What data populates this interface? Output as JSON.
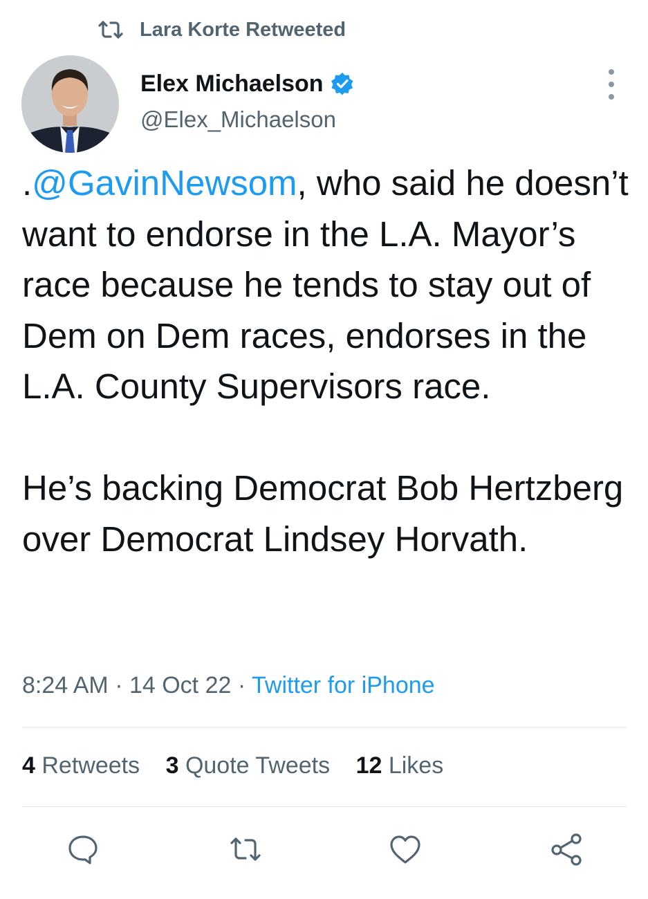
{
  "retweet_context": {
    "label": "Lara Korte Retweeted",
    "icon": "retweet-icon"
  },
  "author": {
    "name": "Elex Michaelson",
    "handle": "@Elex_Michaelson",
    "verified": true,
    "verified_icon": "verified-badge-icon"
  },
  "tweet": {
    "text_prefix": ".",
    "mention": "@GavinNewsom",
    "paragraph1_rest": ", who said he doesn’t want to endorse in the L.A. Mayor’s race because he tends to stay out of Dem on Dem races, endorses in the L.A. County Supervisors race.",
    "paragraph2": "He’s backing Democrat Bob Hertzberg over Democrat Lindsey Horvath."
  },
  "meta": {
    "time": "8:24 AM",
    "sep1": " · ",
    "date": "14 Oct 22",
    "sep2": " · ",
    "source": "Twitter for iPhone"
  },
  "stats": {
    "retweets_count": "4",
    "retweets_label": "Retweets",
    "quotes_count": "3",
    "quotes_label": "Quote Tweets",
    "likes_count": "12",
    "likes_label": "Likes"
  },
  "actions": [
    "reply-icon",
    "retweet-icon",
    "like-icon",
    "share-icon"
  ],
  "colors": {
    "accent": "#1d9bf0",
    "secondary_text": "#536471",
    "primary_text": "#0f1419",
    "divider": "#e1e6ea"
  }
}
